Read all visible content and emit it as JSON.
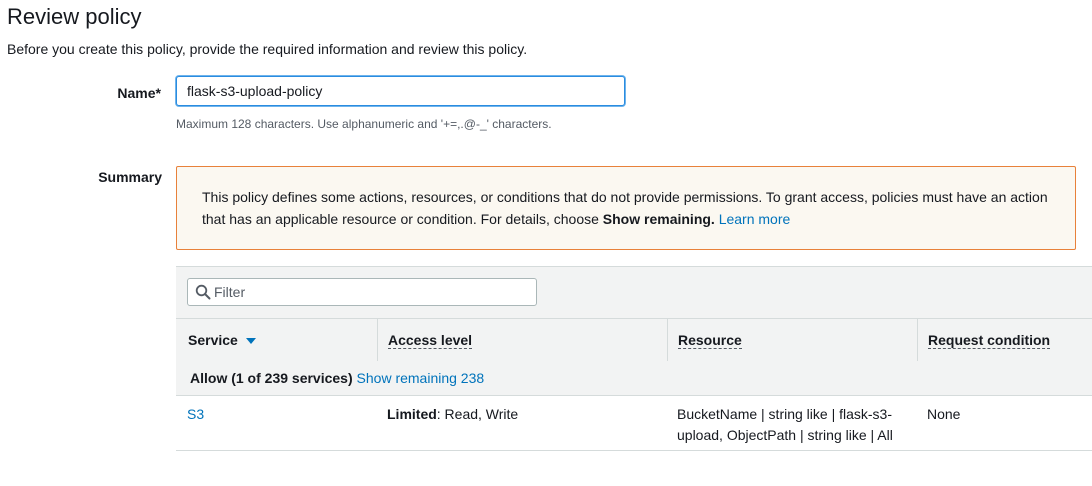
{
  "page": {
    "title": "Review policy",
    "description": "Before you create this policy, provide the required information and review this policy."
  },
  "name_field": {
    "label": "Name*",
    "value": "flask-s3-upload-policy",
    "hint": "Maximum 128 characters. Use alphanumeric and '+=,.@-_' characters."
  },
  "summary": {
    "label": "Summary",
    "warning": {
      "text_part1": "This policy defines some actions, resources, or conditions that do not provide permissions. To grant access, policies must have an action that has an applicable resource or condition. For details, choose ",
      "bold_text": "Show remaining.",
      "link_text": "Learn more"
    },
    "filter_placeholder": "Filter",
    "columns": [
      "Service",
      "Access level",
      "Resource",
      "Request condition"
    ],
    "group": {
      "label": "Allow (1 of 239 services)",
      "link": "Show remaining 238"
    },
    "rows": [
      {
        "service": "S3",
        "access_level_bold": "Limited",
        "access_level_rest": ": Read, Write",
        "resource": "BucketName | string like | flask-s3-upload, ObjectPath | string like | All",
        "request_condition": "None"
      }
    ]
  },
  "colors": {
    "link": "#0073bb",
    "warning_border": "#e8813a",
    "warning_bg": "#fbf8f1",
    "header_bg": "#f2f3f3"
  },
  "icons": {
    "filter": "search-icon",
    "sort": "caret-down-icon"
  }
}
